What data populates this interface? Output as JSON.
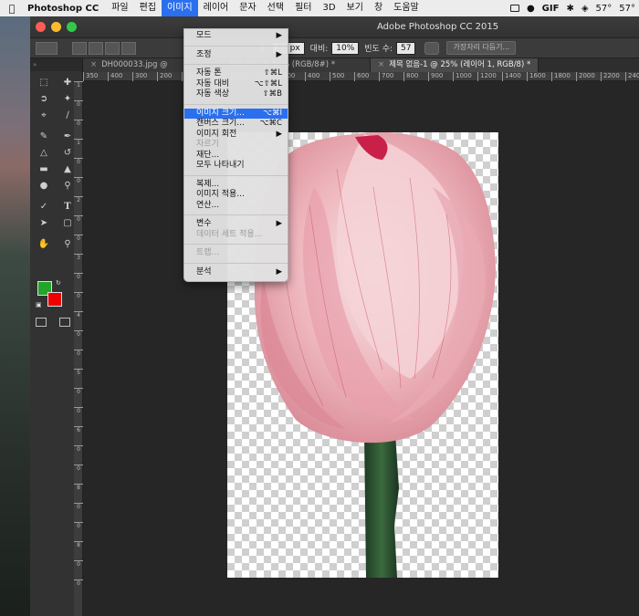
{
  "menubar": {
    "app": "Photoshop CC",
    "items": [
      "파일",
      "편집",
      "이미지",
      "레이어",
      "문자",
      "선택",
      "필터",
      "3D",
      "보기",
      "창",
      "도움말"
    ],
    "active_index": 2,
    "status": [
      "57°",
      "57°"
    ]
  },
  "window": {
    "title": "Adobe Photoshop CC 2015"
  },
  "options": {
    "width_label": "폭:",
    "width_value": "10 px",
    "contrast_label": "대비:",
    "contrast_value": "10%",
    "freq_label": "빈도 수:",
    "freq_value": "57",
    "refine_button": "가장자리 다듬기..."
  },
  "tabs": [
    {
      "label": "DH000033.jpg @",
      "active": false
    },
    {
      "label": "859.JPG @ 50% (RGB/8#) *",
      "active": false
    },
    {
      "label": "제목 없음-1 @ 25% (레이어 1, RGB/8) *",
      "active": true
    }
  ],
  "ruler": {
    "top": [
      "350",
      "400",
      "300",
      "200",
      "100",
      "0",
      "100",
      "200",
      "300",
      "400",
      "500",
      "600",
      "700",
      "800",
      "900",
      "1000",
      "1200",
      "1400",
      "1600",
      "1800",
      "2000",
      "2200",
      "2400"
    ],
    "left": [
      "1",
      "0",
      "0",
      "1",
      "0",
      "0",
      "2",
      "0",
      "0",
      "3",
      "0",
      "0",
      "4",
      "0",
      "0",
      "5",
      "0",
      "0",
      "6",
      "0",
      "0",
      "8",
      "0",
      "0",
      "8",
      "0",
      "0"
    ]
  },
  "image_menu": {
    "sections": [
      [
        {
          "label": "모드",
          "shortcut": "",
          "submenu": true,
          "disabled": false
        }
      ],
      [
        {
          "label": "조정",
          "shortcut": "",
          "submenu": true,
          "disabled": false
        }
      ],
      [
        {
          "label": "자동 톤",
          "shortcut": "⇧⌘L",
          "submenu": false,
          "disabled": false
        },
        {
          "label": "자동 대비",
          "shortcut": "⌥⇧⌘L",
          "submenu": false,
          "disabled": false
        },
        {
          "label": "자동 색상",
          "shortcut": "⇧⌘B",
          "submenu": false,
          "disabled": false
        }
      ],
      [
        {
          "label": "이미지 크기...",
          "shortcut": "⌥⌘I",
          "submenu": false,
          "disabled": false,
          "highlight": true
        },
        {
          "label": "캔버스 크기...",
          "shortcut": "⌥⌘C",
          "submenu": false,
          "disabled": false
        },
        {
          "label": "이미지 회전",
          "shortcut": "",
          "submenu": true,
          "disabled": false
        },
        {
          "label": "자르기",
          "shortcut": "",
          "submenu": false,
          "disabled": true
        },
        {
          "label": "재단...",
          "shortcut": "",
          "submenu": false,
          "disabled": false
        },
        {
          "label": "모두 나타내기",
          "shortcut": "",
          "submenu": false,
          "disabled": false
        }
      ],
      [
        {
          "label": "복제...",
          "shortcut": "",
          "submenu": false,
          "disabled": false
        },
        {
          "label": "이미지 적용...",
          "shortcut": "",
          "submenu": false,
          "disabled": false
        },
        {
          "label": "연산...",
          "shortcut": "",
          "submenu": false,
          "disabled": false
        }
      ],
      [
        {
          "label": "변수",
          "shortcut": "",
          "submenu": true,
          "disabled": false
        },
        {
          "label": "데이터 세트 적용...",
          "shortcut": "",
          "submenu": false,
          "disabled": true
        }
      ],
      [
        {
          "label": "트랩...",
          "shortcut": "",
          "submenu": false,
          "disabled": true
        }
      ],
      [
        {
          "label": "분석",
          "shortcut": "",
          "submenu": true,
          "disabled": false
        }
      ]
    ]
  },
  "colors": {
    "foreground": "#24a42b",
    "background": "#ee0000",
    "menu_highlight": "#2a6ff0"
  }
}
